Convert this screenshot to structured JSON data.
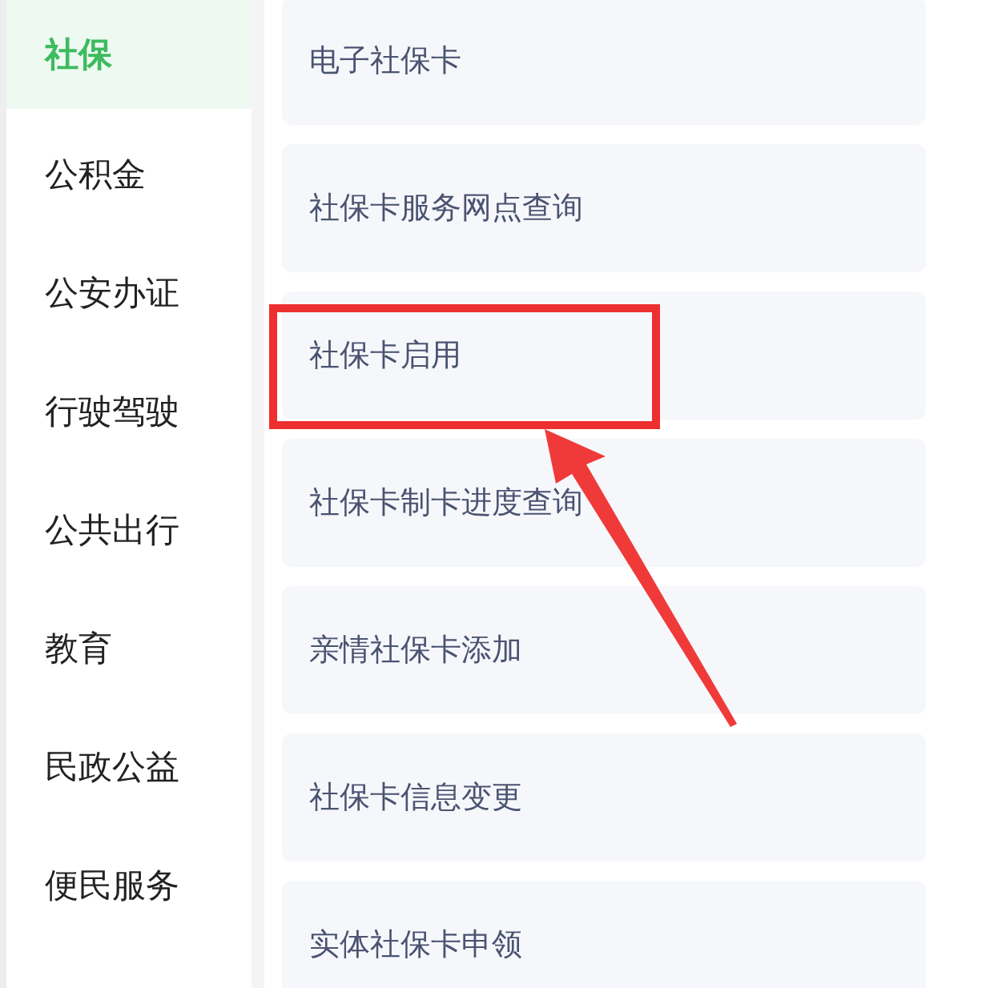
{
  "sidebar": {
    "items": [
      {
        "label": "社保",
        "selected": true
      },
      {
        "label": "公积金",
        "selected": false
      },
      {
        "label": "公安办证",
        "selected": false
      },
      {
        "label": "行驶驾驶",
        "selected": false
      },
      {
        "label": "公共出行",
        "selected": false
      },
      {
        "label": "教育",
        "selected": false
      },
      {
        "label": "民政公益",
        "selected": false
      },
      {
        "label": "便民服务",
        "selected": false
      }
    ]
  },
  "services": [
    {
      "label": "电子社保卡",
      "highlighted": false
    },
    {
      "label": "社保卡服务网点查询",
      "highlighted": false
    },
    {
      "label": "社保卡启用",
      "highlighted": true
    },
    {
      "label": "社保卡制卡进度查询",
      "highlighted": false
    },
    {
      "label": "亲情社保卡添加",
      "highlighted": false
    },
    {
      "label": "社保卡信息变更",
      "highlighted": false
    },
    {
      "label": "实体社保卡申领",
      "highlighted": false
    }
  ]
}
